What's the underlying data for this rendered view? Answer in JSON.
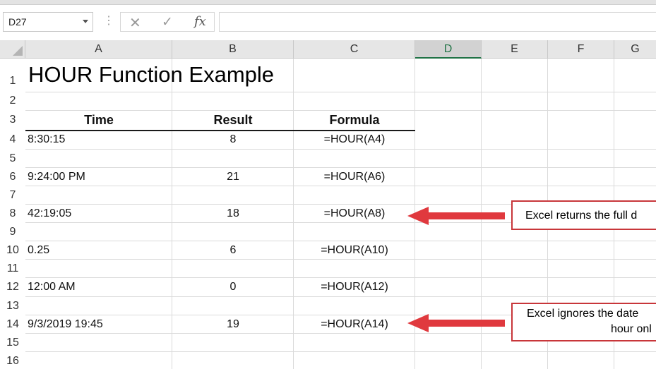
{
  "formula_bar": {
    "name_box": "D27",
    "cancel_icon": "✕",
    "enter_icon": "✓",
    "fx_label": "fx",
    "formula": ""
  },
  "columns": [
    "A",
    "B",
    "C",
    "D",
    "E",
    "F",
    "G"
  ],
  "selected_column": "D",
  "rows": [
    "1",
    "2",
    "3",
    "4",
    "5",
    "6",
    "7",
    "8",
    "9",
    "10",
    "11",
    "12",
    "13",
    "14",
    "15",
    "16"
  ],
  "sheet": {
    "title": "HOUR Function Example",
    "headers": {
      "time": "Time",
      "result": "Result",
      "formula": "Formula"
    },
    "data": [
      {
        "row": 4,
        "time": "8:30:15",
        "result": "8",
        "formula": "=HOUR(A4)"
      },
      {
        "row": 6,
        "time": "9:24:00 PM",
        "result": "21",
        "formula": "=HOUR(A6)"
      },
      {
        "row": 8,
        "time": "42:19:05",
        "result": "18",
        "formula": "=HOUR(A8)"
      },
      {
        "row": 10,
        "time": "0.25",
        "result": "6",
        "formula": "=HOUR(A10)"
      },
      {
        "row": 12,
        "time": "12:00 AM",
        "result": "0",
        "formula": "=HOUR(A12)"
      },
      {
        "row": 14,
        "time": "9/3/2019 19:45",
        "result": "19",
        "formula": "=HOUR(A14)"
      }
    ]
  },
  "callouts": {
    "first": "Excel returns the full d",
    "second_line1": "Excel ignores the date",
    "second_line2": "hour onl"
  },
  "colors": {
    "accent_red": "#e0393e",
    "selected_col": "#217346"
  }
}
